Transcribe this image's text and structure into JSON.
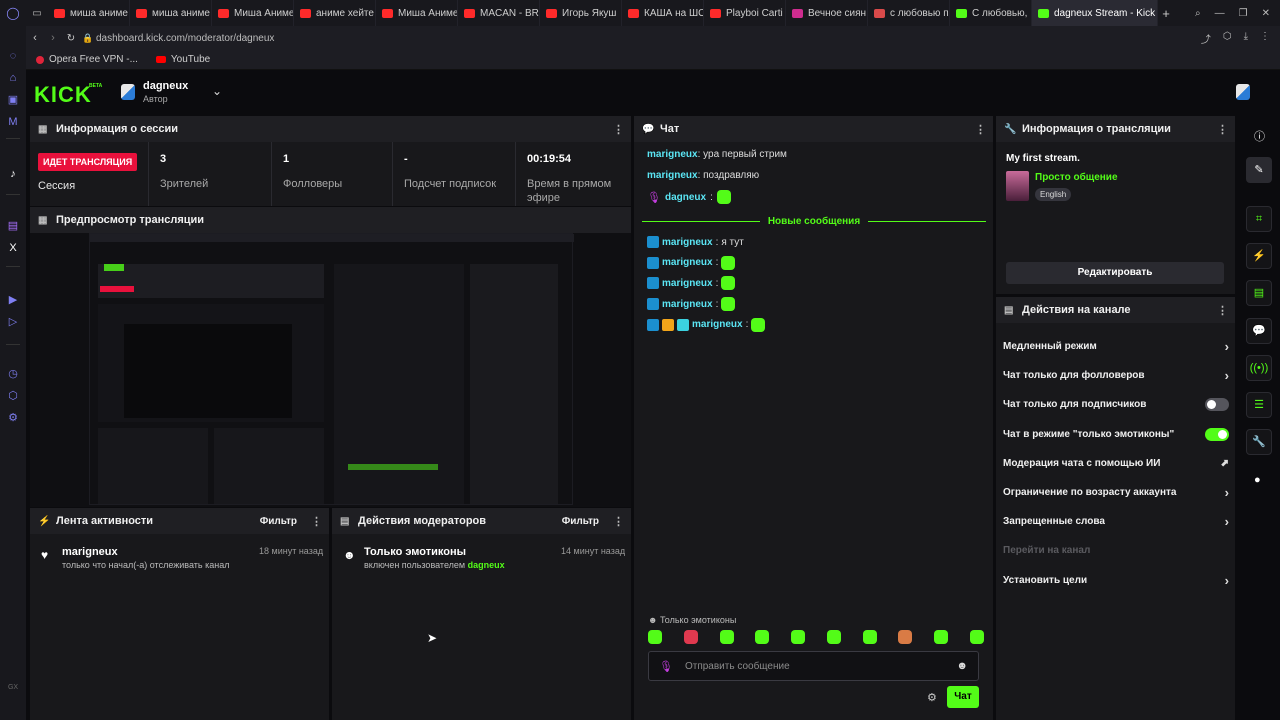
{
  "browser": {
    "tabs": [
      {
        "label": "миша аниме",
        "color": "#ff2a2a"
      },
      {
        "label": "миша аниме",
        "color": "#ff2a2a"
      },
      {
        "label": "Миша Аниме",
        "color": "#ff2a2a"
      },
      {
        "label": "аниме хейте",
        "color": "#ff2a2a"
      },
      {
        "label": "Миша Аниме",
        "color": "#ff2a2a"
      },
      {
        "label": "MACAN - BR",
        "color": "#ff2a2a"
      },
      {
        "label": "Игорь Якуш",
        "color": "#ff2a2a"
      },
      {
        "label": "КАША на ШО",
        "color": "#ff2a2a"
      },
      {
        "label": "Playboi Carti",
        "color": "#ff2a2a"
      },
      {
        "label": "Вечное сиян",
        "color": "#cf2c8f"
      },
      {
        "label": "с любовью п",
        "color": "#d94a4a"
      },
      {
        "label": "С любовью,",
        "color": "#53fc18"
      },
      {
        "label": "dagneux Stream - Kick",
        "color": "#53fc18"
      }
    ],
    "url": "dashboard.kick.com/moderator/dagneux",
    "bookmarks": [
      "Opera Free VPN -...",
      "YouTube"
    ]
  },
  "header": {
    "logo": "KICK",
    "logo_badge": "BETA",
    "channel_name": "dagneux",
    "channel_role": "Автор"
  },
  "session": {
    "title": "Информация о сессии",
    "live_badge": "ИДЕТ ТРАНСЛЯЦИЯ",
    "live_label": "Сессия",
    "stats": [
      {
        "value": "3",
        "label": "Зрителей"
      },
      {
        "value": "1",
        "label": "Фолловеры"
      },
      {
        "value": "-",
        "label": "Подсчет подписок"
      },
      {
        "value": "00:19:54",
        "label": "Время в прямом эфире"
      }
    ]
  },
  "preview": {
    "title": "Предпросмотр трансляции"
  },
  "activity": {
    "title": "Лента активности",
    "filter": "Фильтр",
    "items": [
      {
        "user": "marigneux",
        "text": "только что начал(-а) отслеживать канал",
        "time": "18 минут назад"
      }
    ]
  },
  "mod_actions": {
    "title": "Действия модераторов",
    "filter": "Фильтр",
    "items": [
      {
        "action": "Только эмотиконы",
        "text": "включен пользователем",
        "user": "dagneux",
        "time": "14 минут назад"
      }
    ]
  },
  "chat": {
    "title": "Чат",
    "messages_before": [
      {
        "user": "marigneux",
        "text": "ура первый стрим"
      },
      {
        "user": "marigneux",
        "text": "поздравляю"
      }
    ],
    "author_message": {
      "user": "dagneux"
    },
    "new_divider": "Новые сообщения",
    "messages_after": [
      {
        "user": "marigneux",
        "text": "я тут"
      },
      {
        "user": "marigneux",
        "text": ""
      },
      {
        "user": "marigneux",
        "text": ""
      },
      {
        "user": "marigneux",
        "text": ""
      },
      {
        "user": "marigneux",
        "text": ""
      }
    ],
    "emote_only_label": "Только эмотиконы",
    "emote_colors": [
      "#53fc18",
      "#e0394f",
      "#53fc18",
      "#53fc18",
      "#53fc18",
      "#53fc18",
      "#53fc18",
      "#d97b45",
      "#53fc18",
      "#53fc18"
    ],
    "placeholder": "Отправить сообщение",
    "send_label": "Чат"
  },
  "stream_info": {
    "title": "Информация о трансляции",
    "stream_title": "My first stream.",
    "category": "Просто общение",
    "language": "English",
    "edit_label": "Редактировать"
  },
  "channel_actions": {
    "title": "Действия на канале",
    "items": [
      {
        "label": "Медленный режим",
        "control": "chevron"
      },
      {
        "label": "Чат только для фолловеров",
        "control": "chevron"
      },
      {
        "label": "Чат только для подписчиков",
        "control": "toggle-off"
      },
      {
        "label": "Чат в режиме \"только эмотиконы\"",
        "control": "toggle-on"
      },
      {
        "label": "Модерация чата с помощью ИИ",
        "control": "external"
      },
      {
        "label": "Ограничение по возрасту аккаунта",
        "control": "chevron"
      },
      {
        "label": "Запрещенные слова",
        "control": "chevron"
      },
      {
        "label": "Перейти на канал",
        "control": "disabled"
      },
      {
        "label": "Установить цели",
        "control": "chevron"
      }
    ]
  },
  "colors": {
    "accent": "#53fc18",
    "live": "#e9113c",
    "username": "#5be6f5"
  }
}
